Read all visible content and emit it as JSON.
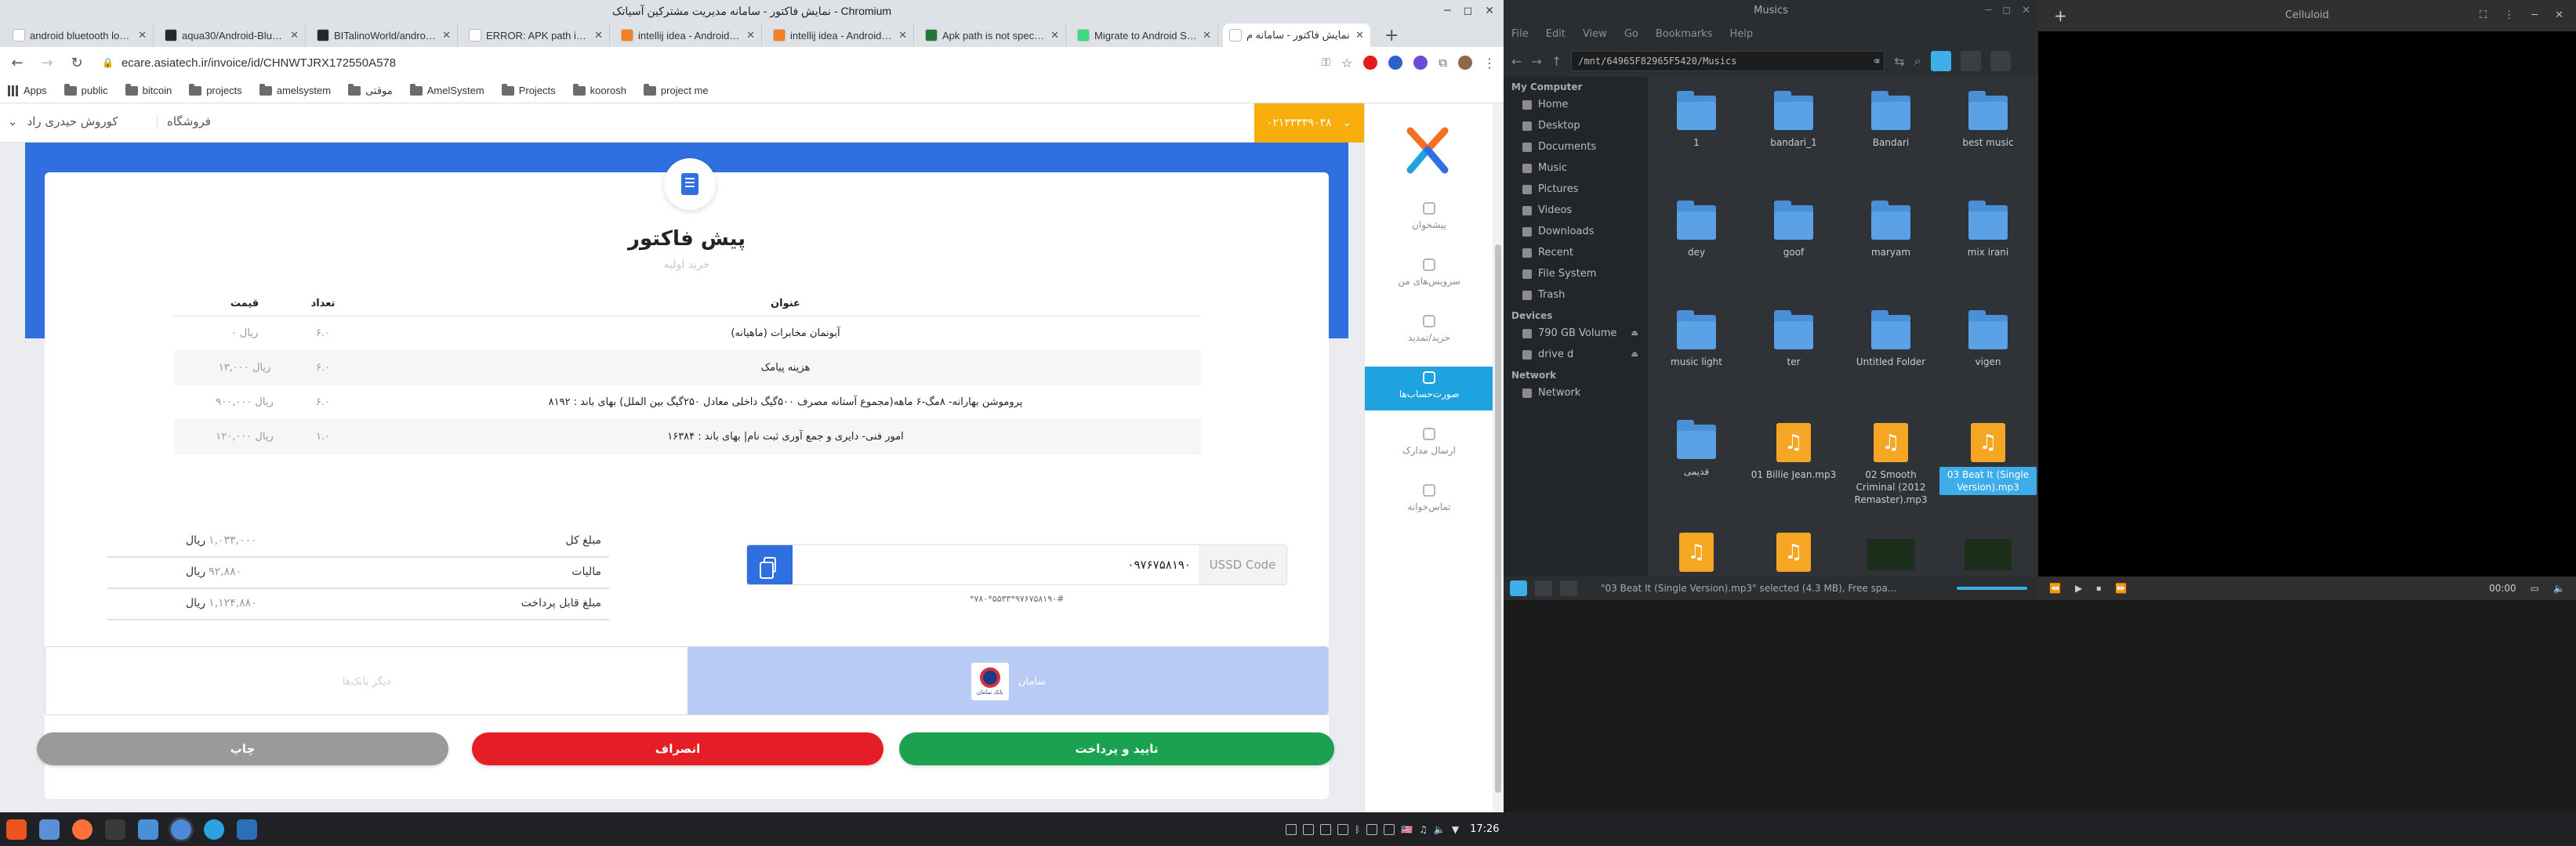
{
  "chrome": {
    "window_title": "نمایش فاکتور - سامانه مدیریت مشترکین آسیاتک - Chromium",
    "tabs": [
      {
        "label": "android bluetooth logge",
        "color": "#ffffff"
      },
      {
        "label": "aqua30/Android-Bluetoo",
        "color": "#24292e"
      },
      {
        "label": "BITalinoWorld/android-a",
        "color": "#24292e"
      },
      {
        "label": "ERROR: APK path is not",
        "color": "#ffffff"
      },
      {
        "label": "intellij idea - Android AP",
        "color": "#f48024"
      },
      {
        "label": "intellij idea - Android St",
        "color": "#f48024"
      },
      {
        "label": "Apk path is not specifie",
        "color": "#1e7a3a"
      },
      {
        "label": "Migrate to Android Stud",
        "color": "#3ddc84"
      },
      {
        "label": "نمایش فاکتور - سامانه م",
        "color": "#ffffff",
        "active": true
      }
    ],
    "url": "ecare.asiatech.ir/invoice/id/CHNWTJRX172550A578",
    "bookmarks": [
      "Apps",
      "public",
      "bitcoin",
      "projects",
      "amelsystem",
      "موقتی",
      "AmelSystem",
      "Projects",
      "koorosh",
      "project me"
    ]
  },
  "site": {
    "user_name": "کوروش حیدری راد",
    "store_label": "فروشگاه",
    "phone": "۰۲۱۳۳۳۳۹۰۳۸",
    "sidebar": [
      {
        "label": "پیشخوان"
      },
      {
        "label": "سرویس‌های من"
      },
      {
        "label": "خرید/تمدید"
      },
      {
        "label": "صورت‌حساب‌ها",
        "active": true
      },
      {
        "label": "ارسال مدارک"
      },
      {
        "label": "تماس‌خوانه"
      }
    ]
  },
  "invoice": {
    "title": "پیش فاکتور",
    "subtitle": "خرید اولیه",
    "headers": {
      "title": "عنوان",
      "qty": "تعداد",
      "price": "قیمت"
    },
    "items": [
      {
        "title": "آبونمان مخابرات (ماهیانه)",
        "qty": "۶.۰",
        "price": "۰ ریال"
      },
      {
        "title": "هزینه پیامک",
        "qty": "۶.۰",
        "price": "۱۳,۰۰۰ ریال"
      },
      {
        "title": "پروموشن بهارانه- ۸مگ-۶ ماهه(مجموع آستانه مصرف ۵۰۰گیگ داخلی معادل ۲۵۰گیگ بین الملل) بهای باند : ۸۱۹۲",
        "qty": "۶.۰",
        "price": "۹۰۰,۰۰۰ ریال"
      },
      {
        "title": "امور فنی- دایری و جمع آوری ثبت نام| بهای باند : ۱۶۳۸۴",
        "qty": "۱.۰",
        "price": "۱۲۰,۰۰۰ ریال"
      }
    ],
    "totals": [
      {
        "label": "مبلغ کل",
        "value": "۱,۰۳۳,۰۰۰",
        "unit": "ریال"
      },
      {
        "label": "مالیات",
        "value": "۹۲,۸۸۰",
        "unit": "ریال"
      },
      {
        "label": "مبلغ قابل پرداخت",
        "value": "۱,۱۲۴,۸۸۰",
        "unit": "ریال"
      }
    ],
    "ussd_label": "USSD Code",
    "ussd_code": "۰۹۷۶۷۵۸۱۹۰",
    "ussd_sub": "*۷۸۰*۵۵۳۳*۹۷۶۷۵۸۱۹۰#",
    "bank_selected": "سامان",
    "bank_logo_text": "بانک سامان",
    "bank_other": "دیگر بانک‌ها",
    "btn_print": "چاپ",
    "btn_cancel": "انصراف",
    "btn_confirm": "تایید و پرداخت"
  },
  "filemanager": {
    "title": "Musics",
    "menu": [
      "File",
      "Edit",
      "View",
      "Go",
      "Bookmarks",
      "Help"
    ],
    "path": "/mnt/64965F82965F5420/Musics",
    "sections": {
      "my_computer": "My Computer",
      "devices": "Devices",
      "network": "Network"
    },
    "places": [
      "Home",
      "Desktop",
      "Documents",
      "Music",
      "Pictures",
      "Videos",
      "Downloads",
      "Recent",
      "File System",
      "Trash"
    ],
    "devices": [
      "790 GB Volume",
      "drive d"
    ],
    "network_items": [
      "Network"
    ],
    "files": [
      {
        "name": "1",
        "type": "folder"
      },
      {
        "name": "bandari_1",
        "type": "folder"
      },
      {
        "name": "Bandari",
        "type": "folder"
      },
      {
        "name": "best music",
        "type": "folder"
      },
      {
        "name": "dey",
        "type": "folder"
      },
      {
        "name": "goof",
        "type": "folder"
      },
      {
        "name": "maryam",
        "type": "folder"
      },
      {
        "name": "mix irani",
        "type": "folder"
      },
      {
        "name": "music light",
        "type": "folder"
      },
      {
        "name": "ter",
        "type": "folder"
      },
      {
        "name": "Untitled Folder",
        "type": "folder"
      },
      {
        "name": "vigen",
        "type": "folder"
      },
      {
        "name": "قدیمی",
        "type": "folder"
      },
      {
        "name": "01 Billie Jean.mp3",
        "type": "mp3"
      },
      {
        "name": "02 Smooth Criminal (2012 Remaster).mp3",
        "type": "mp3"
      },
      {
        "name": "03 Beat It (Single Version).mp3",
        "type": "mp3",
        "selected": true
      },
      {
        "name": "",
        "type": "mp3"
      },
      {
        "name": "",
        "type": "mp3"
      },
      {
        "name": "",
        "type": "image"
      },
      {
        "name": "",
        "type": "image"
      }
    ],
    "status": "\"03 Beat It (Single Version).mp3\" selected (4.3 MB), Free spa..."
  },
  "celluloid": {
    "title": "Celluloid",
    "time": "00:00"
  },
  "taskbar": {
    "clock": "17:26"
  }
}
